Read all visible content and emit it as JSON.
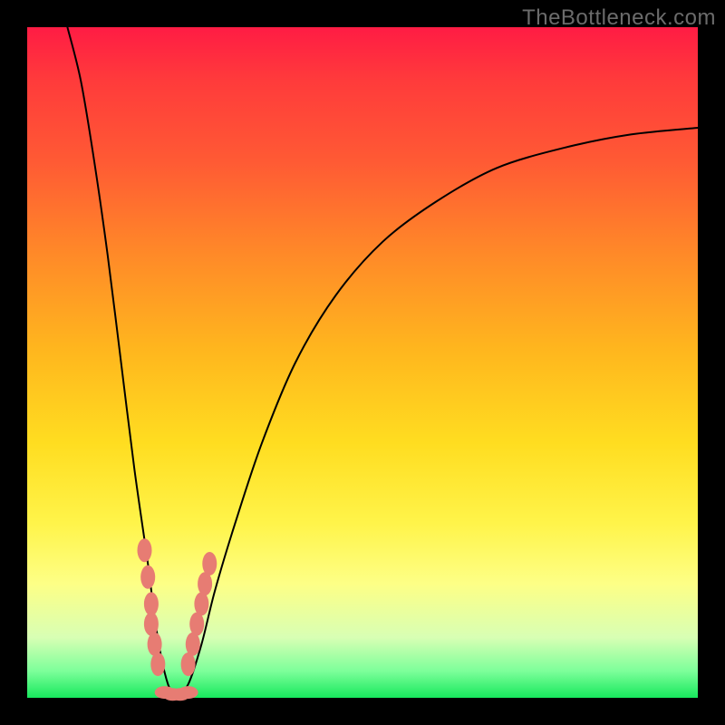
{
  "watermark": "TheBottleneck.com",
  "chart_data": {
    "type": "line",
    "title": "",
    "xlabel": "",
    "ylabel": "",
    "xlim": [
      0,
      100
    ],
    "ylim": [
      0,
      100
    ],
    "grid": false,
    "curve_left": [
      {
        "x": 6,
        "y": 100
      },
      {
        "x": 8,
        "y": 92
      },
      {
        "x": 10,
        "y": 80
      },
      {
        "x": 12,
        "y": 66
      },
      {
        "x": 14,
        "y": 50
      },
      {
        "x": 16,
        "y": 34
      },
      {
        "x": 18,
        "y": 20
      },
      {
        "x": 19,
        "y": 12
      },
      {
        "x": 20,
        "y": 6
      },
      {
        "x": 21,
        "y": 2
      },
      {
        "x": 22,
        "y": 0
      }
    ],
    "curve_right": [
      {
        "x": 22,
        "y": 0
      },
      {
        "x": 24,
        "y": 2
      },
      {
        "x": 26,
        "y": 8
      },
      {
        "x": 28,
        "y": 16
      },
      {
        "x": 31,
        "y": 26
      },
      {
        "x": 35,
        "y": 38
      },
      {
        "x": 40,
        "y": 50
      },
      {
        "x": 46,
        "y": 60
      },
      {
        "x": 53,
        "y": 68
      },
      {
        "x": 61,
        "y": 74
      },
      {
        "x": 70,
        "y": 79
      },
      {
        "x": 80,
        "y": 82
      },
      {
        "x": 90,
        "y": 84
      },
      {
        "x": 100,
        "y": 85
      }
    ],
    "markers_left": [
      {
        "x": 17.5,
        "y": 22
      },
      {
        "x": 18.0,
        "y": 18
      },
      {
        "x": 18.5,
        "y": 14
      },
      {
        "x": 18.5,
        "y": 11
      },
      {
        "x": 19.0,
        "y": 8
      },
      {
        "x": 19.5,
        "y": 5
      }
    ],
    "markers_right": [
      {
        "x": 24.0,
        "y": 5
      },
      {
        "x": 24.7,
        "y": 8
      },
      {
        "x": 25.3,
        "y": 11
      },
      {
        "x": 26.0,
        "y": 14
      },
      {
        "x": 26.5,
        "y": 17
      },
      {
        "x": 27.2,
        "y": 20
      }
    ],
    "markers_bottom": [
      {
        "x": 20.5,
        "y": 0.8
      },
      {
        "x": 21.7,
        "y": 0.5
      },
      {
        "x": 22.8,
        "y": 0.5
      },
      {
        "x": 24.0,
        "y": 0.8
      }
    ]
  }
}
